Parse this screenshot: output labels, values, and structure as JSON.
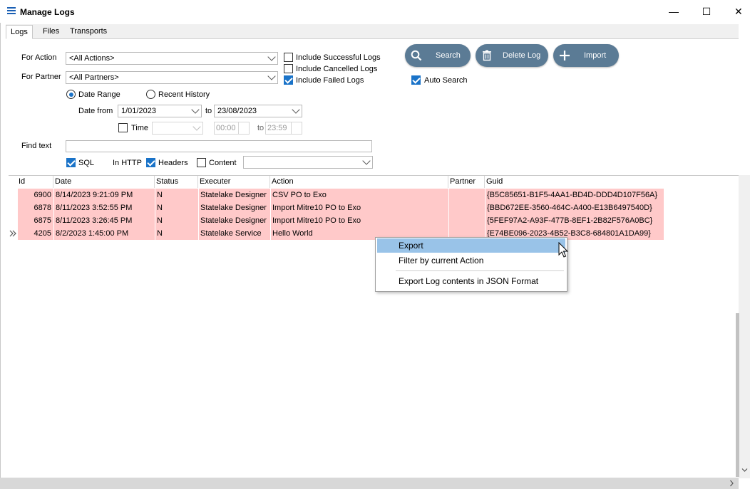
{
  "window": {
    "title": "Manage Logs",
    "minimize": "—",
    "maximize": "☐",
    "close": "✕"
  },
  "tabs": [
    "Logs",
    "Files",
    "Transports"
  ],
  "filters": {
    "for_action_label": "For Action",
    "for_action_value": "<All Actions>",
    "for_partner_label": "For Partner",
    "for_partner_value": "<All Partners>",
    "include_successful": "Include Successful Logs",
    "include_cancelled": "Include Cancelled Logs",
    "include_failed": "Include Failed Logs",
    "auto_search": "Auto Search",
    "date_range": "Date Range",
    "recent_history": "Recent History",
    "date_from_label": "Date from",
    "date_from": "1/01/2023",
    "to_label": "to",
    "date_to": "23/08/2023",
    "time_label": "Time",
    "time_from": "00:00",
    "time_to": "23:59",
    "find_text_label": "Find text",
    "find_text_value": "",
    "sql_label": "SQL",
    "in_http_label": "In HTTP",
    "headers_label": "Headers",
    "content_label": "Content"
  },
  "buttons": {
    "search": "Search",
    "delete_log": "Delete Log",
    "import": "Import"
  },
  "grid": {
    "columns": [
      "Id",
      "Date",
      "Status",
      "Executer",
      "Action",
      "Partner",
      "Guid"
    ],
    "rows": [
      [
        "6900",
        "8/14/2023 9:21:09 PM",
        "N",
        "Statelake Designer",
        "CSV PO to Exo",
        "",
        "{B5C85651-B1F5-4AA1-BD4D-DDD4D107F56A}"
      ],
      [
        "6878",
        "8/11/2023 3:52:55 PM",
        "N",
        "Statelake Designer",
        "Import Mitre10 PO to Exo",
        "",
        "{BBD672EE-3560-464C-A400-E13B6497540D}"
      ],
      [
        "6875",
        "8/11/2023 3:26:45 PM",
        "N",
        "Statelake Designer",
        "Import Mitre10 PO to Exo",
        "",
        "{5FEF97A2-A93F-477B-8EF1-2B82F576A0BC}"
      ],
      [
        "4205",
        "8/2/2023 1:45:00 PM",
        "N",
        "Statelake Service",
        "Hello World",
        "",
        "{E74BE096-2023-4B52-B3C8-684801A1DA99}"
      ]
    ]
  },
  "context_menu": [
    "Export",
    "Filter by current Action",
    "Export Log contents in JSON Format"
  ],
  "colors": {
    "row_fail": "#ffc9c9",
    "button": "#5b7b95",
    "check": "#1a73c8",
    "menu_highlight": "#99c3e8"
  }
}
